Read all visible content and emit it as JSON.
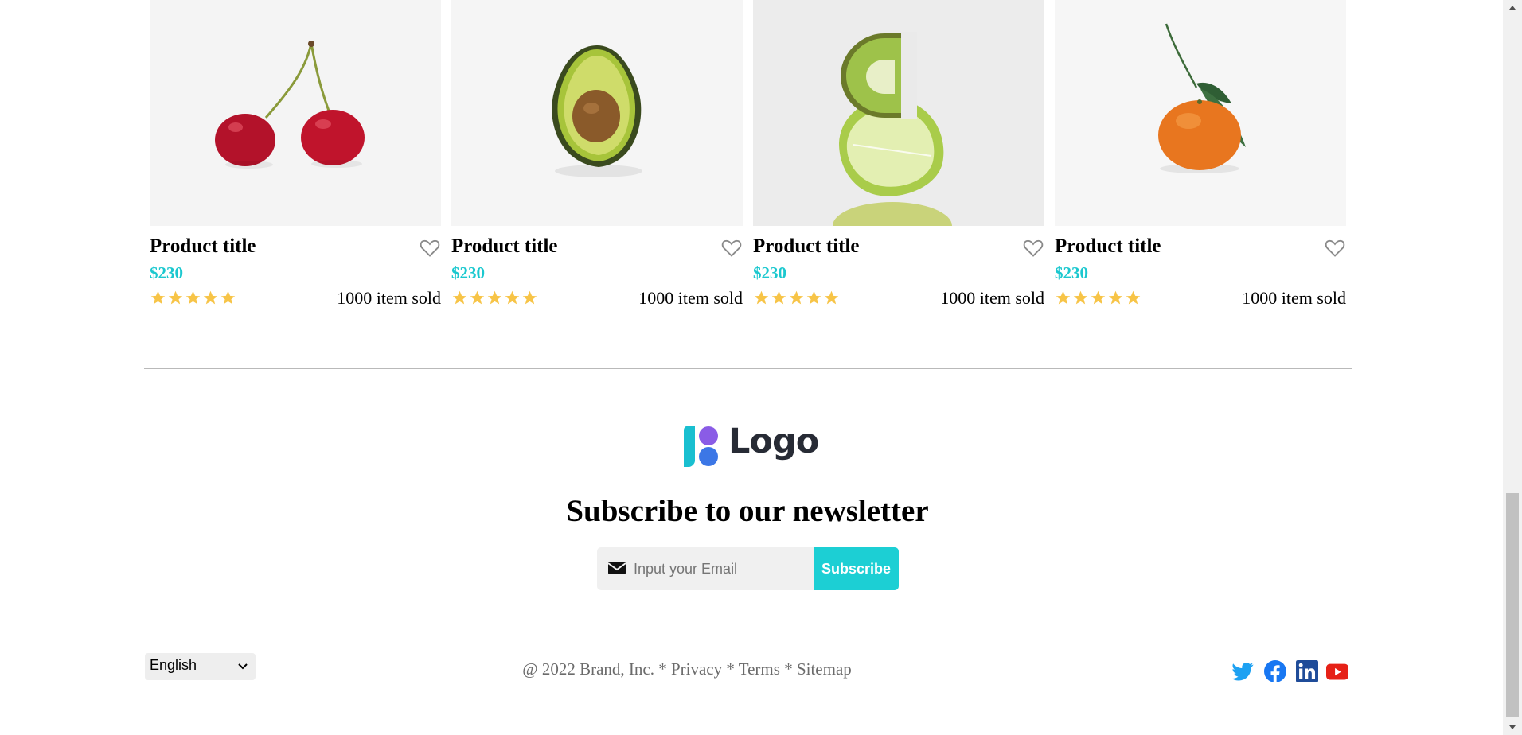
{
  "products": [
    {
      "image": "cherry-photo",
      "title": "Product title",
      "price": "$230",
      "rating": 5,
      "sold": "1000 item sold"
    },
    {
      "image": "avocado-photo",
      "title": "Product title",
      "price": "$230",
      "rating": 5,
      "sold": "1000 item sold"
    },
    {
      "image": "kiwi-lime-photo",
      "title": "Product title",
      "price": "$230",
      "rating": 5,
      "sold": "1000 item sold"
    },
    {
      "image": "tangerine-photo",
      "title": "Product title",
      "price": "$230",
      "rating": 5,
      "sold": "1000 item sold"
    }
  ],
  "footer": {
    "logo_text": "Logo",
    "newsletter_title": "Subscribe to our newsletter",
    "email_placeholder": "Input your Email",
    "subscribe_label": "Subscribe",
    "language": "English",
    "copyright": "@ 2022 Brand, Inc.",
    "separator": " * ",
    "links": [
      "Privacy",
      "Terms",
      "Sitemap"
    ],
    "social": [
      "twitter-icon",
      "facebook-icon",
      "linkedin-icon",
      "youtube-icon"
    ]
  },
  "colors": {
    "accent": "#1bc8cf",
    "star": "#f7c447",
    "heart_outline": "#8a8a8a"
  }
}
